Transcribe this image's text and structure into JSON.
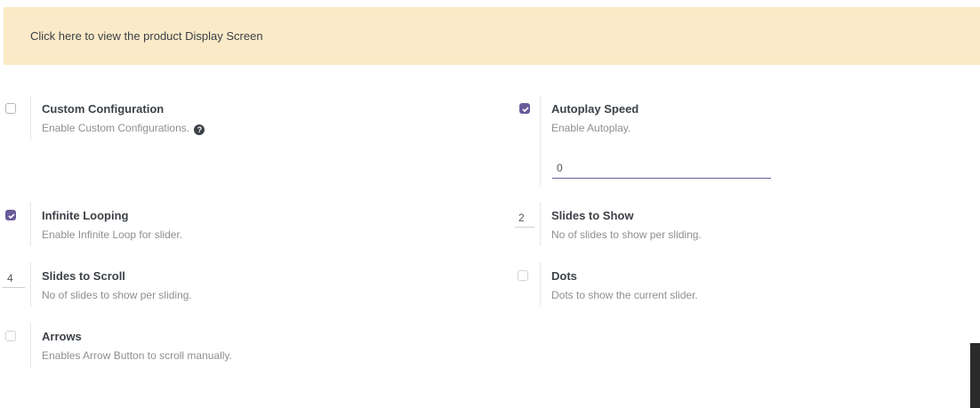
{
  "banner": {
    "link_text": "Click here to view the product Display Screen"
  },
  "settings": {
    "custom_configuration": {
      "title": "Custom Configuration",
      "description": "Enable Custom Configurations.",
      "checked": false,
      "help_icon": "question-circle-icon"
    },
    "autoplay_speed": {
      "title": "Autoplay Speed",
      "description": "Enable Autoplay.",
      "checked": true,
      "value": "0"
    },
    "infinite_looping": {
      "title": "Infinite Looping",
      "description": "Enable Infinite Loop for slider.",
      "checked": true
    },
    "slides_to_show": {
      "title": "Slides to Show",
      "description": "No of slides to show per sliding.",
      "value": "2"
    },
    "slides_to_scroll": {
      "title": "Slides to Scroll",
      "description": "No of slides to show per sliding.",
      "value": "4"
    },
    "dots": {
      "title": "Dots",
      "description": "Dots to show the current slider.",
      "checked": false
    },
    "arrows": {
      "title": "Arrows",
      "description": "Enables Arrow Button to scroll manually.",
      "checked": false
    }
  },
  "colors": {
    "accent": "#6a5b9a",
    "banner_bg": "#fbeac8"
  }
}
